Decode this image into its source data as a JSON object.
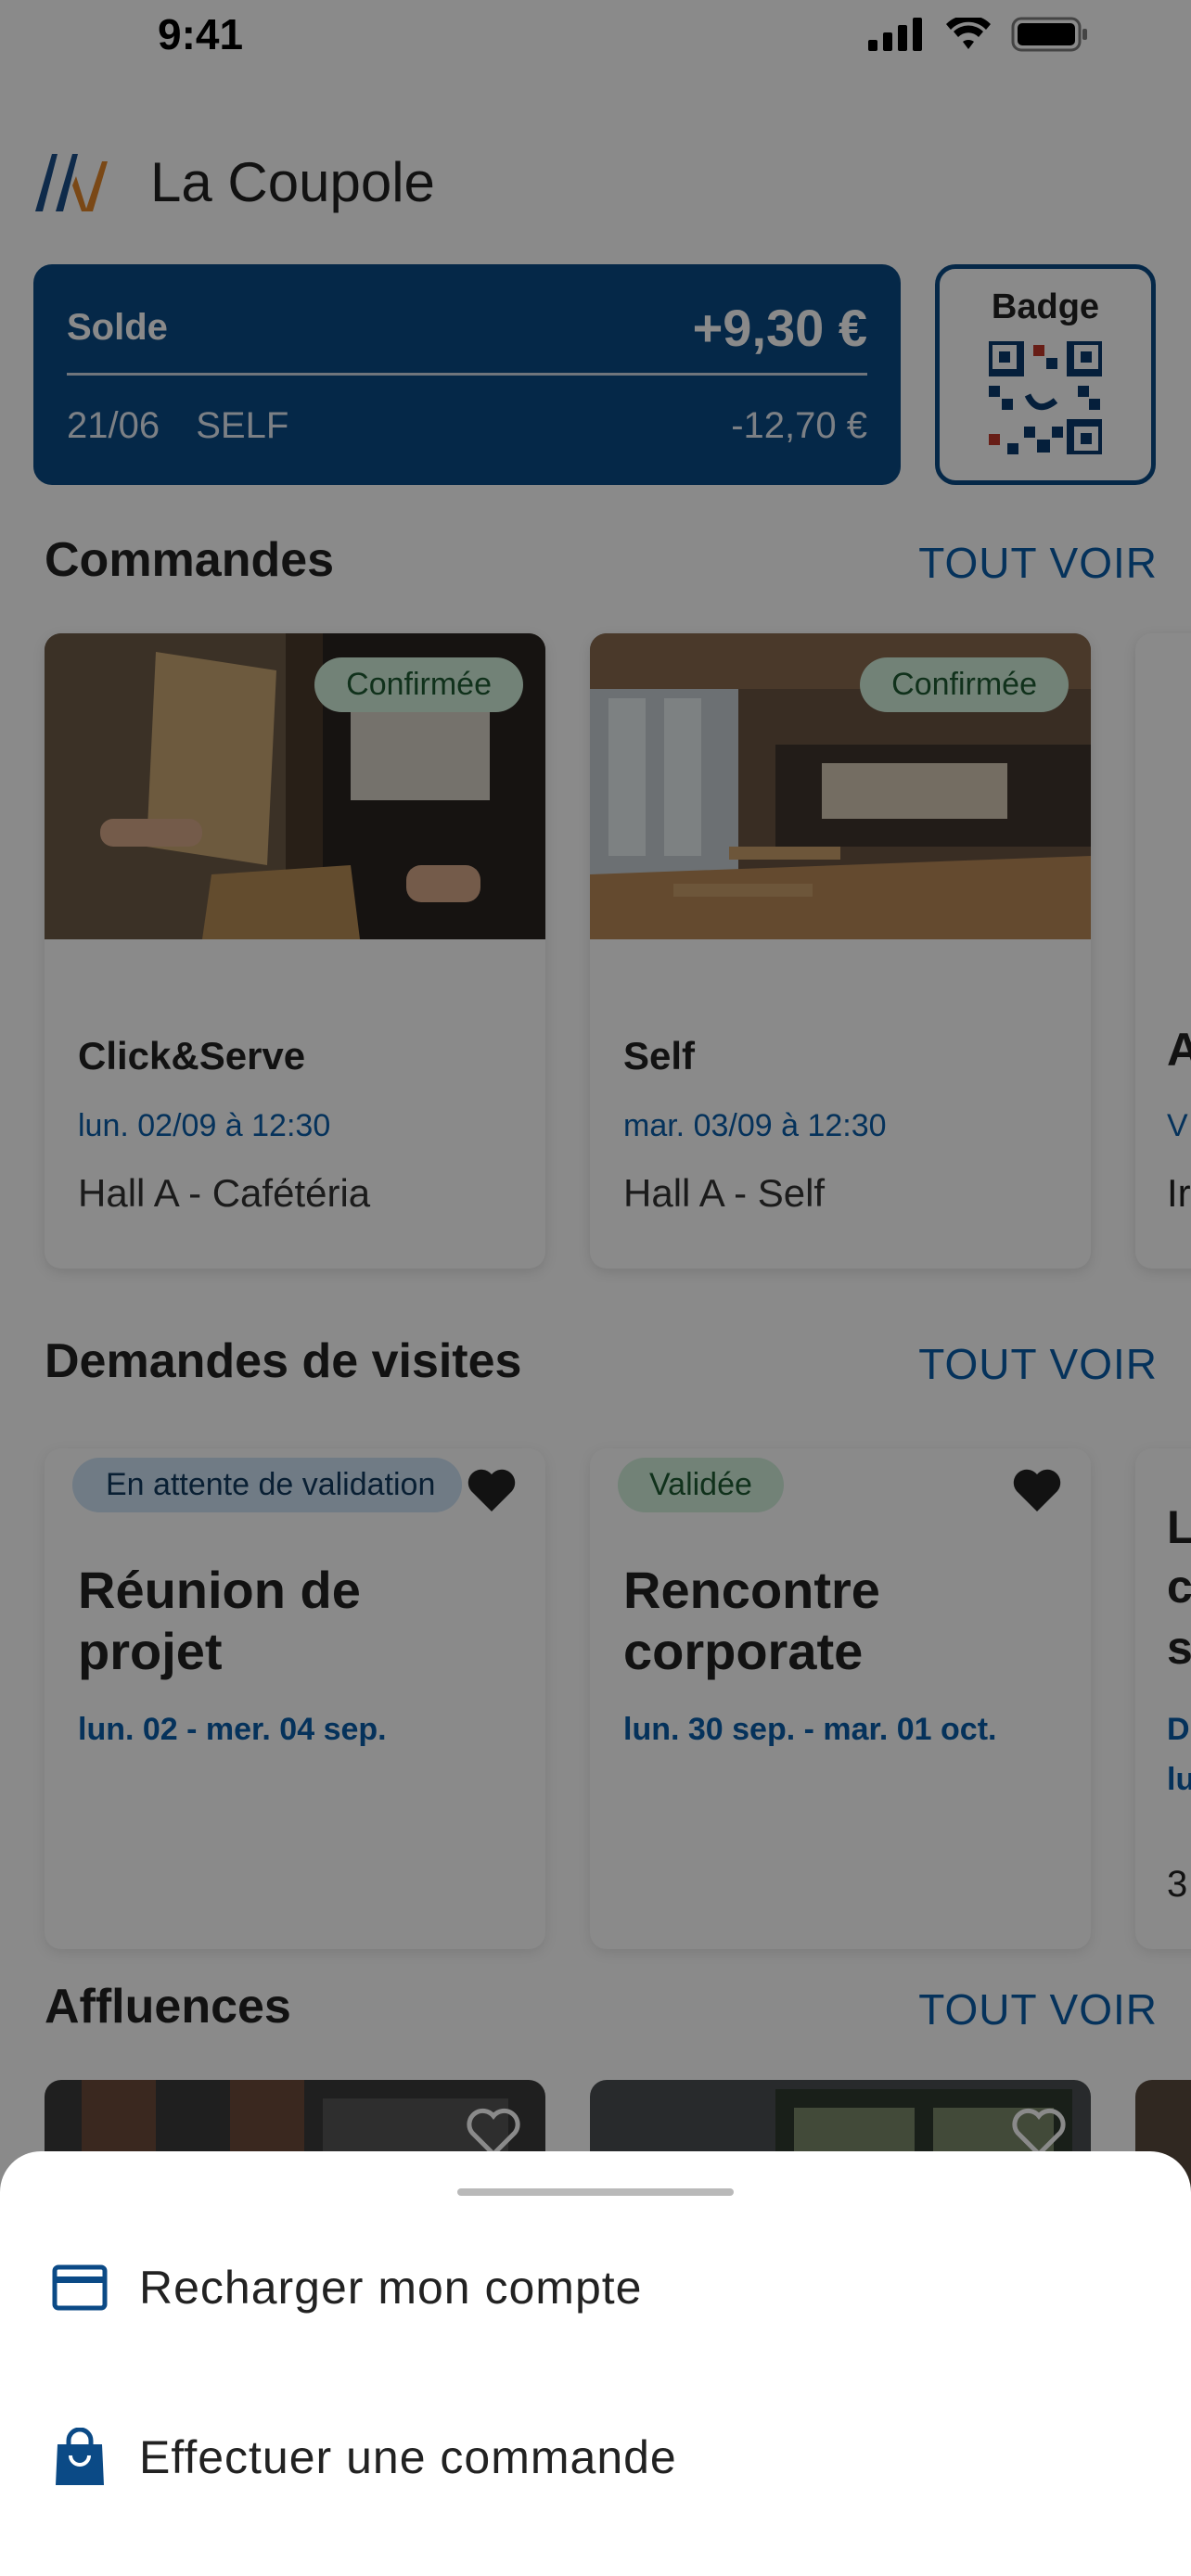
{
  "status_bar": {
    "time": "9:41"
  },
  "header": {
    "title": "La Coupole"
  },
  "balance": {
    "label": "Solde",
    "amount": "+9,30 €",
    "last_transaction": {
      "date": "21/06",
      "type": "SELF",
      "amount": "-12,70 €"
    }
  },
  "badge": {
    "label": "Badge"
  },
  "orders": {
    "title": "Commandes",
    "see_all": "TOUT VOIR",
    "items": [
      {
        "status": "Confirmée",
        "name": "Click&Serve",
        "date": "lun. 02/09 à 12:30",
        "place": "Hall A - Cafétéria"
      },
      {
        "status": "Confirmée",
        "name": "Self",
        "date": "mar. 03/09 à 12:30",
        "place": "Hall A - Self"
      }
    ],
    "peek": {
      "name": "A",
      "date": "V",
      "place": "Ir"
    }
  },
  "visits": {
    "title": "Demandes de visites",
    "see_all": "TOUT VOIR",
    "items": [
      {
        "status": "En attente de validation",
        "title": "Réunion de projet",
        "dates": "lun. 02 - mer. 04 sep."
      },
      {
        "status": "Validée",
        "title": "Rencontre corporate",
        "dates": "lun. 30 sep. - mar. 01 oct."
      }
    ],
    "peek": {
      "line1": "L",
      "line2": "c",
      "line3": "s",
      "line4": "D",
      "line5": "lu",
      "line6": "3"
    }
  },
  "affluences": {
    "title": "Affluences",
    "see_all": "TOUT VOIR"
  },
  "sheet": {
    "items": [
      {
        "label": "Recharger mon compte",
        "icon": "credit-card-icon"
      },
      {
        "label": "Effectuer une commande",
        "icon": "shopping-bag-icon"
      }
    ]
  },
  "colors": {
    "primary": "#0b4a86",
    "link": "#0b5da8",
    "overlay": "rgba(0,0,0,0.46)"
  }
}
